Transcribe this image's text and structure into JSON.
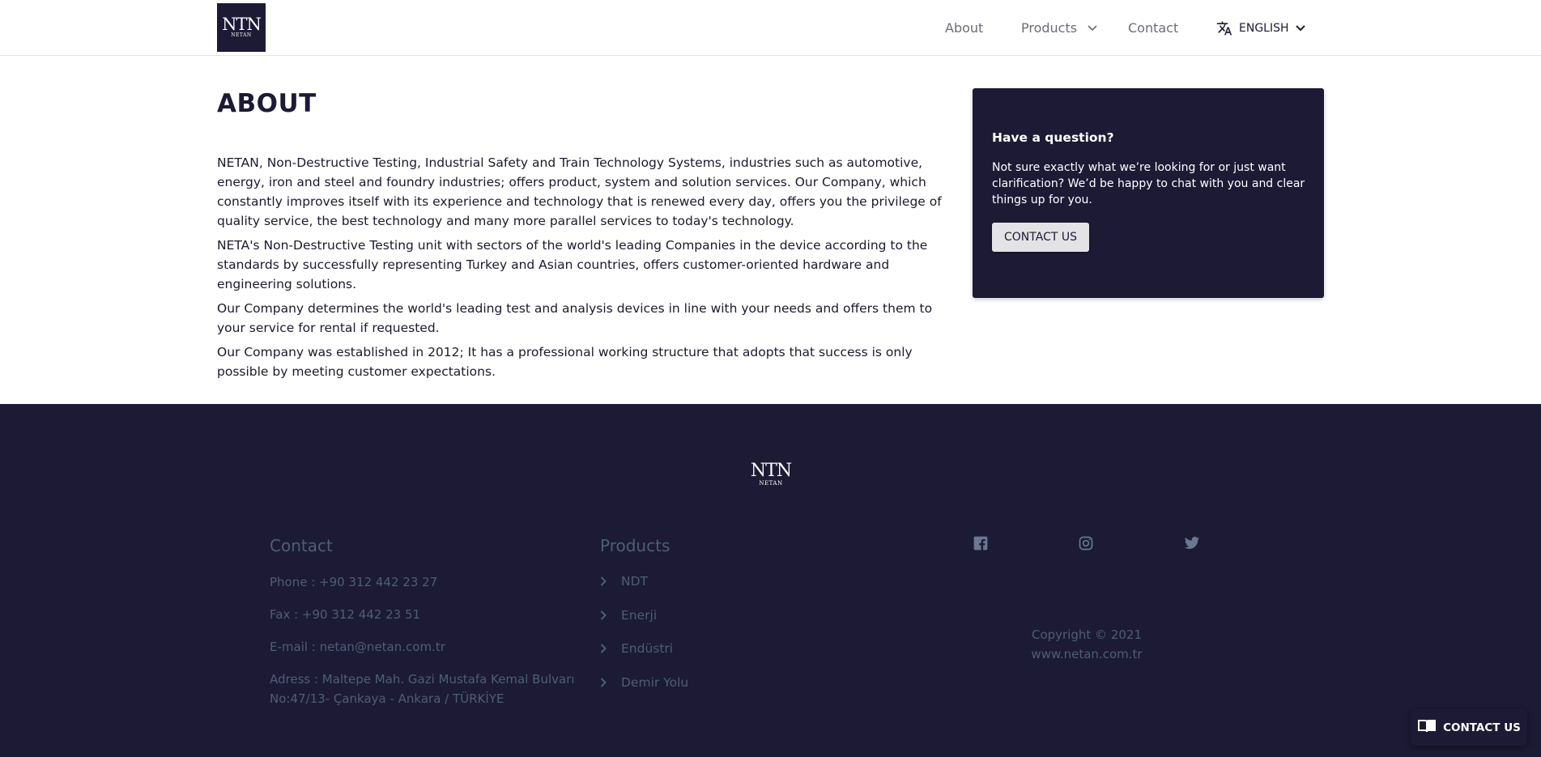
{
  "header": {
    "logo_text": "NTN",
    "logo_subtext": "NETAN",
    "nav": {
      "about": "About",
      "products": "Products",
      "contact": "Contact"
    },
    "language": "ENGLISH"
  },
  "main": {
    "title": "ABOUT",
    "paragraphs": [
      "NETAN, Non-Destructive Testing, Industrial Safety and Train Technology Systems, industries such as automotive, energy, iron and steel and foundry industries; offers product, system and solution services. Our Company, which constantly improves itself with its experience and technology that is renewed every day, offers you the privilege of quality service, the best technology and many more parallel services to today's technology.",
      "NETA's Non-Destructive Testing unit with sectors of the world's leading Companies in the device according to the standards by successfully representing Turkey and Asian countries, offers customer-oriented hardware and engineering solutions.",
      "Our Company determines the world's leading test and analysis devices in line with your needs and offers them to your service for rental if requested.",
      "Our Company was established in 2012; It has a professional working structure that adopts that success is only possible by meeting customer expectations."
    ]
  },
  "question_box": {
    "title": "Have a question?",
    "description": "Not sure exactly what we’re looking for or just want clarification? We’d be happy to chat with you and clear things up for you.",
    "button": "CONTACT US"
  },
  "footer": {
    "logo_text": "NTN",
    "logo_subtext": "NETAN",
    "contact": {
      "heading": "Contact",
      "phone": "Phone : +90 312 442 23 27",
      "fax": "Fax : +90 312 442 23 51",
      "email": "E-mail : netan@netan.com.tr",
      "address_line1": "Adress : Maltepe Mah. Gazi Mustafa Kemal Bulvarı",
      "address_line2": "No:47/13- Çankaya - Ankara / TÜRKİYE"
    },
    "products": {
      "heading": "Products",
      "items": [
        "NDT",
        "Enerji",
        "Endüstri",
        "Demir Yolu"
      ]
    },
    "social_icons": [
      "facebook-icon",
      "instagram-icon",
      "twitter-icon"
    ],
    "copyright": "Copyright © 2021",
    "website": "www.netan.com.tr"
  },
  "floating_button": {
    "label": "CONTACT US",
    "icon": "book-icon"
  },
  "colors": {
    "brand_dark": "#1c1a35",
    "footer_text": "#4e5e77",
    "nav_text": "#6b6b7b"
  }
}
